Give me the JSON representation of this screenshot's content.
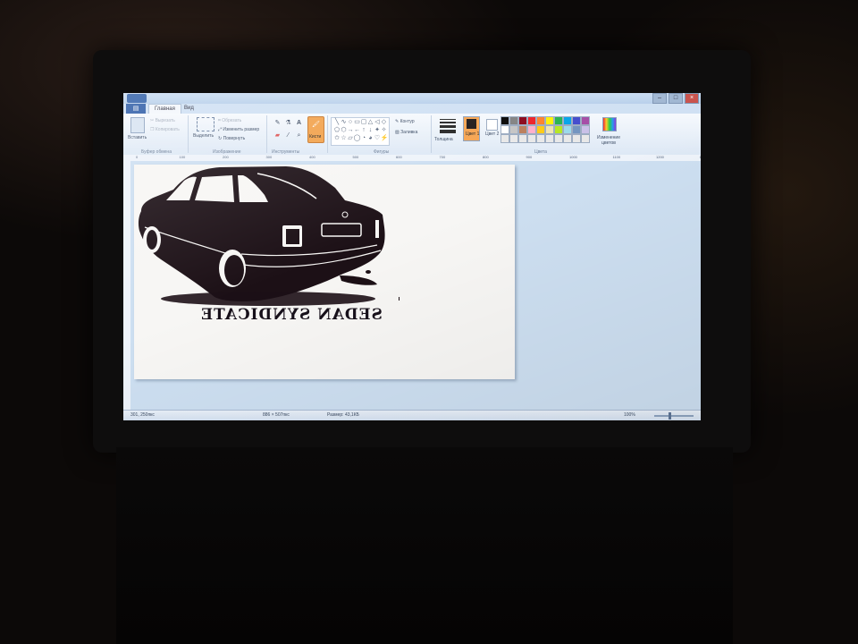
{
  "tabs": [
    {
      "label": "Главная",
      "active": true
    },
    {
      "label": "Вид",
      "active": false
    }
  ],
  "ribbon": {
    "clipboard": {
      "paste": "Вставить",
      "cut": "Вырезать",
      "copy": "Копировать",
      "group": "Буфер обмена"
    },
    "image": {
      "select": "Выделить",
      "crop": "Обрезать",
      "resize": "Изменить размер",
      "rotate": "Повернуть",
      "group": "Изображение"
    },
    "tools": {
      "group": "Инструменты",
      "brush": "Кисти"
    },
    "shapes": {
      "outline": "Контур",
      "fill": "Заливка",
      "group": "Фигуры"
    },
    "thickness": "Толщина",
    "colors": {
      "color1": "Цвет 1",
      "color2": "Цвет 2",
      "edit": "Изменение цветов",
      "group": "Цвета",
      "color1_value": "#1a1414",
      "color2_value": "#ffffff",
      "palette": [
        "#000000",
        "#7f7f7f",
        "#880015",
        "#ed1c24",
        "#ff7f27",
        "#fff200",
        "#22b14c",
        "#00a2e8",
        "#3f48cc",
        "#a349a4",
        "#ffffff",
        "#c3c3c3",
        "#b97a57",
        "#ffaec9",
        "#ffc90e",
        "#efe4b0",
        "#b5e61d",
        "#99d9ea",
        "#7092be",
        "#c8bfe7",
        "#e8e8e8",
        "#e8e8e8",
        "#e8e8e8",
        "#e8e8e8",
        "#e8e8e8",
        "#e8e8e8",
        "#e8e8e8",
        "#e8e8e8",
        "#e8e8e8",
        "#e8e8e8"
      ]
    }
  },
  "ruler_ticks": [
    "0",
    "100",
    "200",
    "300",
    "400",
    "500",
    "600",
    "700",
    "800",
    "900",
    "1000",
    "1100",
    "1200",
    "1300"
  ],
  "canvas": {
    "text": "SEDAN SYNDICATE",
    "car_color": "#1c1016"
  },
  "status": {
    "cursor": "301, 250пкс",
    "size": "886 × 507пкс",
    "filesize": "Размер: 43,1КБ",
    "zoom": "100%"
  },
  "icons": [
    "paste-icon",
    "cut-icon",
    "copy-icon",
    "select-icon",
    "crop-icon",
    "resize-icon",
    "rotate-icon",
    "pencil-icon",
    "fill-icon",
    "text-icon",
    "eraser-icon",
    "picker-icon",
    "magnifier-icon",
    "brush-icon",
    "edit-colors-icon"
  ]
}
